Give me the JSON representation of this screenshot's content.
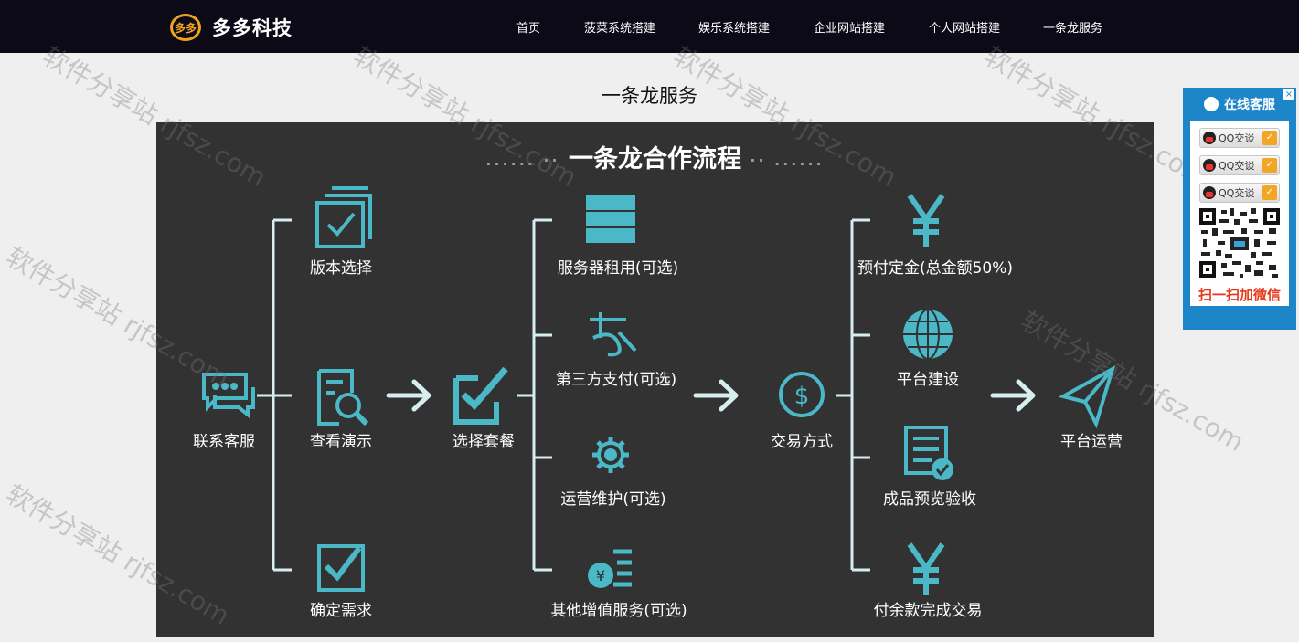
{
  "header": {
    "logo_mark": "多多",
    "logo_text": "多多科技",
    "nav": [
      "首页",
      "菠菜系统搭建",
      "娱乐系统搭建",
      "企业网站搭建",
      "个人网站搭建",
      "一条龙服务"
    ]
  },
  "page_title": "一条龙服务",
  "flow": {
    "title": "一条龙合作流程",
    "dots_left": "...... ··",
    "dots_right": "·· ......",
    "steps": {
      "contact": "联系客服",
      "version": "版本选择",
      "demo": "查看演示",
      "confirm": "确定需求",
      "package": "选择套餐",
      "server": "服务器租用(可选)",
      "payment3": "第三方支付(可选)",
      "ops": "运营维护(可选)",
      "other": "其他增值服务(可选)",
      "trade": "交易方式",
      "deposit": "预付定金(总金额50%)",
      "build": "平台建设",
      "preview": "成品预览验收",
      "balance": "付余款完成交易",
      "operate": "平台运营"
    }
  },
  "widget": {
    "title": "在线客服",
    "close": "×",
    "qq_buttons": [
      "QQ交谈",
      "QQ交谈",
      "QQ交谈"
    ],
    "qr_caption": "扫一扫加微信"
  },
  "watermark": "软件分享站 rjfsz.com",
  "colors": {
    "header_bg": "#0c0a17",
    "flow_bg": "#323232",
    "accent": "#4ab8c6",
    "widget_bg": "#1d86c8",
    "logo": "#f0a21c"
  }
}
